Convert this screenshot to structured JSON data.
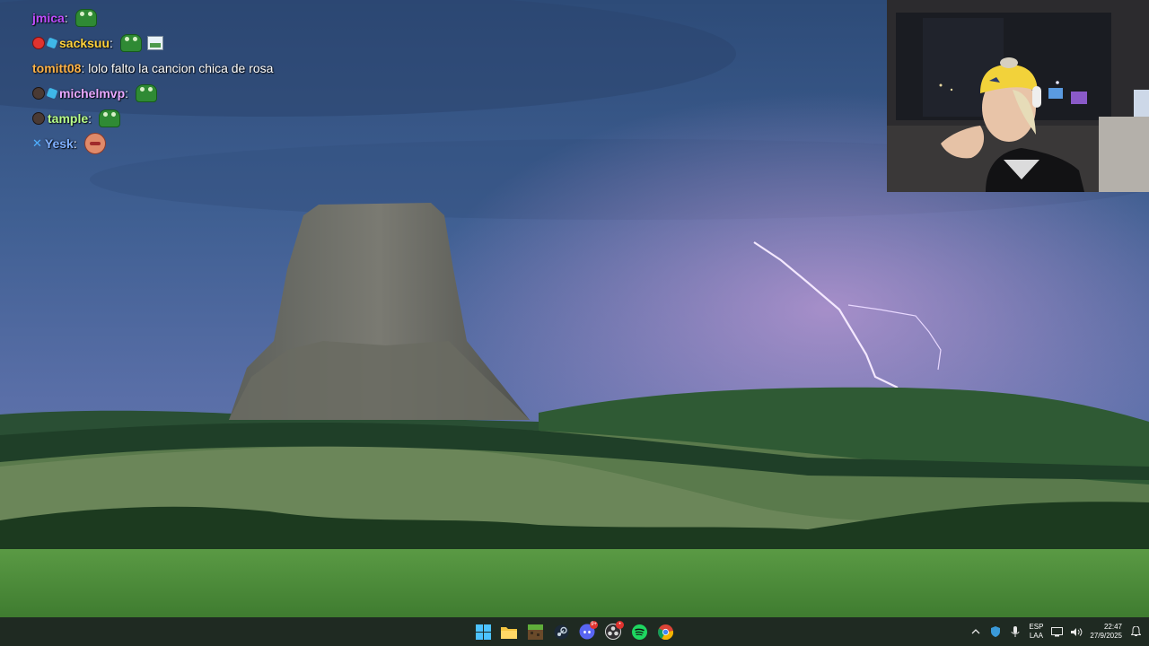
{
  "chat": {
    "messages": [
      {
        "user": "jmica",
        "color": "#c04cff",
        "badges": [],
        "text": "",
        "emotes": [
          "frog"
        ]
      },
      {
        "user": "sacksuu",
        "color": "#ffd23a",
        "badges": [
          "red",
          "cube"
        ],
        "text": "",
        "emotes": [
          "frog",
          "image"
        ]
      },
      {
        "user": "tomitt08",
        "color": "#ffb347",
        "badges": [],
        "text": "lolo falto la cancion chica de rosa",
        "emotes": []
      },
      {
        "user": "michelmvp",
        "color": "#e8a8ff",
        "badges": [
          "face",
          "cube"
        ],
        "text": "",
        "emotes": [
          "frog"
        ]
      },
      {
        "user": "tample",
        "color": "#b8ff8a",
        "badges": [
          "face"
        ],
        "text": "",
        "emotes": [
          "frog"
        ]
      },
      {
        "user": "Yesk",
        "color": "#7fb0ff",
        "badges": [
          "tick"
        ],
        "text": "",
        "emotes": [
          "face"
        ]
      }
    ]
  },
  "taskbar": {
    "apps": [
      {
        "name": "windows-start-icon"
      },
      {
        "name": "file-explorer-icon"
      },
      {
        "name": "minecraft-icon"
      },
      {
        "name": "steam-icon"
      },
      {
        "name": "discord-icon",
        "badge": "9+"
      },
      {
        "name": "obs-icon",
        "badge": "•"
      },
      {
        "name": "spotify-icon"
      },
      {
        "name": "chrome-icon"
      }
    ],
    "tray": {
      "lang_line1": "ESP",
      "lang_line2": "LAA",
      "time": "22:47",
      "date": "27/9/2025"
    }
  },
  "colors": {
    "taskbar_bg": "#1f2a22",
    "sky_top": "#2e4b78",
    "grass": "#4f8f3c"
  }
}
